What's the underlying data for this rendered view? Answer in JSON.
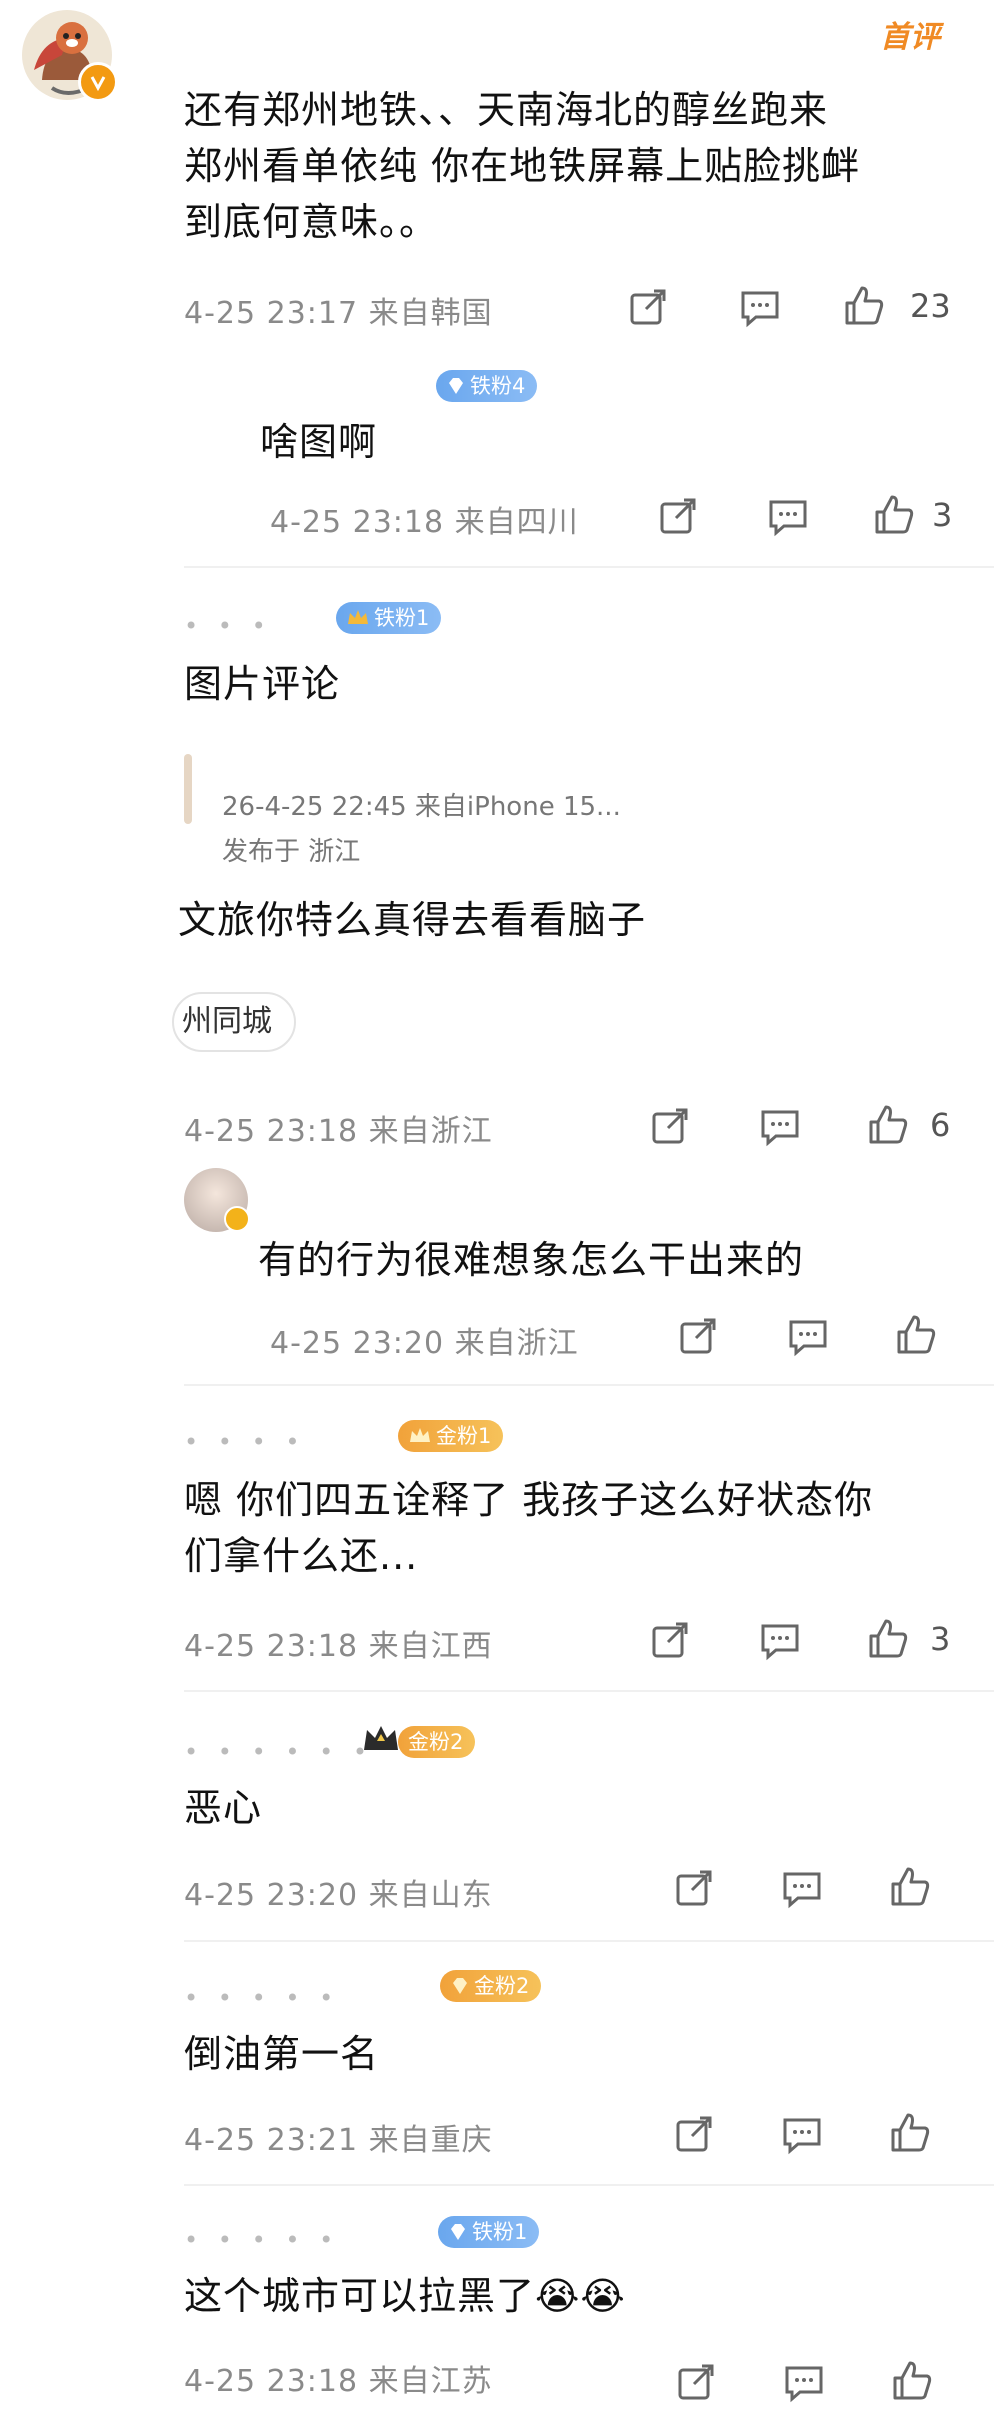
{
  "first_review_tag": "首评",
  "comments": [
    {
      "text_lines": [
        "还有郑州地铁、、天南海北的醇丝跑来",
        "郑州看单依纯 你在地铁屏幕上贴脸挑衅",
        "到底何意味。。"
      ],
      "meta": "4-25 23:17 来自韩国",
      "likes": "23"
    },
    {
      "badge": "铁粉4",
      "text": "啥图啊",
      "meta": "4-25 23:18 来自四川",
      "likes": "3"
    },
    {
      "badge": "铁粉1",
      "badge_level": "5",
      "text": "图片评论",
      "quoted_meta": "26-4-25 22:45  来自iPhone 15...",
      "quoted_location": "发布于 浙江",
      "quoted_text": "文旅你特么真得去看看脑子",
      "chip": "州同城",
      "meta": "4-25 23:18 来自浙江",
      "likes": "6"
    },
    {
      "text": "有的行为很难想象怎么干出来的",
      "meta": "4-25 23:20 来自浙江",
      "likes": ""
    },
    {
      "badge": "金粉1",
      "badge_level": "1",
      "text_lines": [
        "嗯 你们四五诠释了 我孩子这么好状态你",
        "们拿什么还..."
      ],
      "meta": "4-25 23:18 来自江西",
      "likes": "3"
    },
    {
      "badge": "金粉2",
      "badge_level": "1",
      "text": "恶心",
      "meta": "4-25 23:20 来自山东",
      "likes": ""
    },
    {
      "badge": "金粉2",
      "text": "倒油第一名",
      "meta": "4-25 23:21 来自重庆",
      "likes": ""
    },
    {
      "badge": "铁粉1",
      "text": "这个城市可以拉黑了😭😭",
      "meta": "4-25 23:18 来自江苏",
      "likes": ""
    }
  ],
  "colors": {
    "first_review": "#f08a24",
    "iron_badge": "#7fb2f2",
    "gold_badge": "#f2ae45",
    "meta_text": "#8a8a8a"
  },
  "icons": [
    "share-icon",
    "comment-icon",
    "like-icon",
    "diamond-icon",
    "crown-icon",
    "verified-icon"
  ]
}
